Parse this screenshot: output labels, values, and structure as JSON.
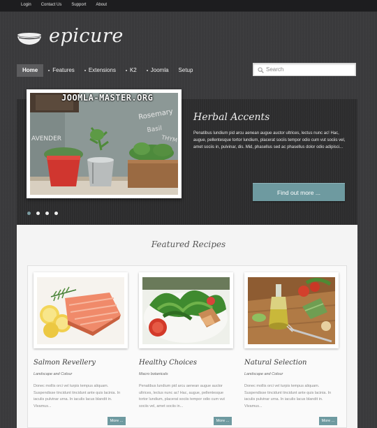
{
  "topbar": {
    "links": [
      "Login",
      "Contact Us",
      "Support",
      "About"
    ]
  },
  "logo": {
    "text": "epicure"
  },
  "nav": {
    "items": [
      "Home",
      "Features",
      "Extensions",
      "K2",
      "Joomla",
      "Setup"
    ]
  },
  "search": {
    "placeholder": "Search"
  },
  "slider": {
    "watermark": "JOOMLA-MASTER.ORG",
    "chalkboard_words": [
      "Rosemary",
      "Basil",
      "AVENDER",
      "THYM"
    ],
    "title": "Herbal Accents",
    "text": "Penatibus lundium pid arcu aenean augue auctor ultrices, lectus nunc ac! Hac, augue, pellentesque tortor lundium, placerat sociis tempor odio cum vut sociis vel, amet sociis in, pulvinar, dis. Mid, phasellus sed ac phasellus dolor odio adipisci...",
    "button": "Find out more ...",
    "dots": 4,
    "active_dot": 0
  },
  "featured": {
    "title": "Featured Recipes"
  },
  "recipes": [
    {
      "title": "Salmon Revellery",
      "subtitle": "Landscape and Colour",
      "body": "Donec mollis orci vel turpis tempus aliquam. Suspendisse tincidunt tincidunt ante quis lacinia. In iaculis pulvinar urna. In iaculis lacus blandit in. Vivamus...",
      "more": "More ..."
    },
    {
      "title": "Healthy Choices",
      "subtitle": "Macro botanicals",
      "body": "Penatibus lundium pid arcu aenean augue auctor ultrices, lectus nunc ac! Hac, augue, pellentesque tortor lundium, placerat sociis tempor odio cum vut sociis vel, amet sociis in...",
      "more": "More ..."
    },
    {
      "title": "Natural Selection",
      "subtitle": "Landscape and Colour",
      "body": "Donec mollis orci vel turpis tempus aliquam. Suspendisse tincidunt tincidunt ante quis lacinia. In iaculis pulvinar urna. In iaculis lacus blandit in. Vivamus...",
      "more": "More ..."
    }
  ],
  "colors": {
    "accent": "#6e9aa0",
    "background": "#3a3a3c",
    "topbar": "#1d1d1f",
    "content": "#f4f4f4"
  }
}
